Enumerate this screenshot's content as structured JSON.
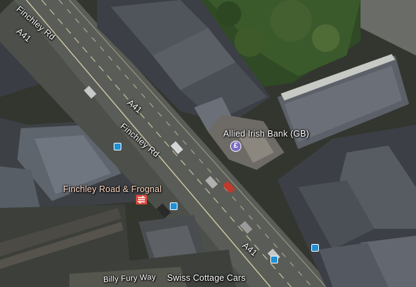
{
  "map": {
    "view": "satellite",
    "labels": {
      "finchley_rd_top": "Finchley Rd",
      "finchley_rd_mid": "Finchley Rd",
      "a41_top": "A41",
      "a41_mid": "A41",
      "a41_bottom": "A41",
      "bank": "Allied Irish Bank (GB)",
      "station": "Finchley Road & Frognal",
      "street_bottom": "Billy Fury Way",
      "cars": "Swiss Cottage Cars"
    },
    "icons": {
      "bank": "pound-bank-icon",
      "rail": "national-rail-icon",
      "bus": "bus-stop-icon"
    },
    "colors": {
      "road": "#5a5d57",
      "road_marking": "#c9c2a0",
      "roof_dark": "#3c4046",
      "roof_light": "#6b7078",
      "vegetation": "#2f4a25",
      "bank_icon": "#7c6cc4",
      "rail_icon": "#d94a3d",
      "bus_icon": "#1f8fd6"
    }
  }
}
